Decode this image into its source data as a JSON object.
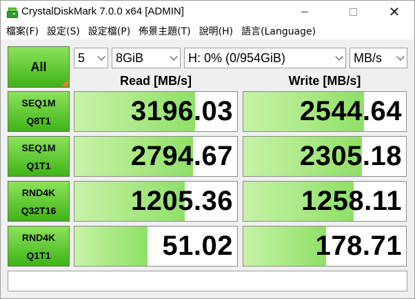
{
  "window": {
    "title": "CrystalDiskMark 7.0.0 x64 [ADMIN]"
  },
  "menu": [
    {
      "label": "檔案(F)"
    },
    {
      "label": "設定(S)"
    },
    {
      "label": "設定檔(P)"
    },
    {
      "label": "佈景主題(T)"
    },
    {
      "label": "說明(H)"
    },
    {
      "label": "語言(Language)"
    }
  ],
  "controls": {
    "all_label": "All",
    "count": "5",
    "size": "8GiB",
    "drive": "H: 0% (0/954GiB)",
    "unit": "MB/s"
  },
  "headers": {
    "read": "Read [MB/s]",
    "write": "Write [MB/s]"
  },
  "tests": [
    {
      "line1": "SEQ1M",
      "line2": "Q8T1",
      "read": "3196.03",
      "write": "2544.64",
      "read_fill": 0.74,
      "write_fill": 0.74
    },
    {
      "line1": "SEQ1M",
      "line2": "Q1T1",
      "read": "2794.67",
      "write": "2305.18",
      "read_fill": 0.73,
      "write_fill": 0.73
    },
    {
      "line1": "RND4K",
      "line2": "Q32T16",
      "read": "1205.36",
      "write": "1258.11",
      "read_fill": 0.68,
      "write_fill": 0.68
    },
    {
      "line1": "RND4K",
      "line2": "Q1T1",
      "read": "51.02",
      "write": "178.71",
      "read_fill": 0.45,
      "write_fill": 0.51
    }
  ],
  "status": {
    "text": ""
  },
  "colors": {
    "accent_green": "#3fb318",
    "bar_green": "#8fe067",
    "corner_orange": "#f07a1a"
  },
  "icons": {
    "app": "disk-icon",
    "minimize": "minimize-icon",
    "maximize": "maximize-icon",
    "close": "close-icon"
  }
}
